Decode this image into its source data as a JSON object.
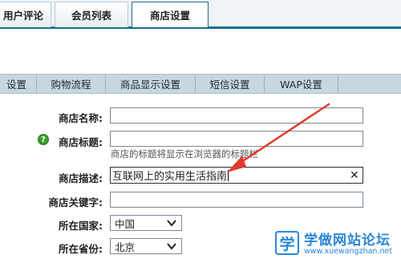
{
  "top_tabs": [
    "用户评论",
    "会员列表",
    "商店设置"
  ],
  "sub_tabs": [
    "设置",
    "购物流程",
    "商品显示设置",
    "短信设置",
    "WAP设置",
    ""
  ],
  "form": {
    "shop_name_label": "商店名称:",
    "shop_title_label": "商店标题:",
    "shop_title_hint": "商店的标题将显示在浏览器的标题栏",
    "shop_desc_label": "商店描述:",
    "shop_desc_value": "互联网上的实用生活指南",
    "shop_keywords_label": "商店关键字:",
    "country_label": "所在国家:",
    "country_value": "中国",
    "province_label": "所在省份:",
    "province_value": "北京"
  },
  "icons": {
    "help": "help-icon",
    "clear": "close-icon",
    "dropdown": "chevron-down-icon"
  },
  "watermark": {
    "badge": "学",
    "title": "学做网站论坛",
    "url": "www.xuewangzhan.net"
  },
  "colors": {
    "tab_border": "#1b6d8f",
    "sub_bar": "#c6d7e0",
    "arrow": "#e03a2e",
    "watermark": "#2a86d8",
    "help_icon": "#3a9a2a"
  }
}
